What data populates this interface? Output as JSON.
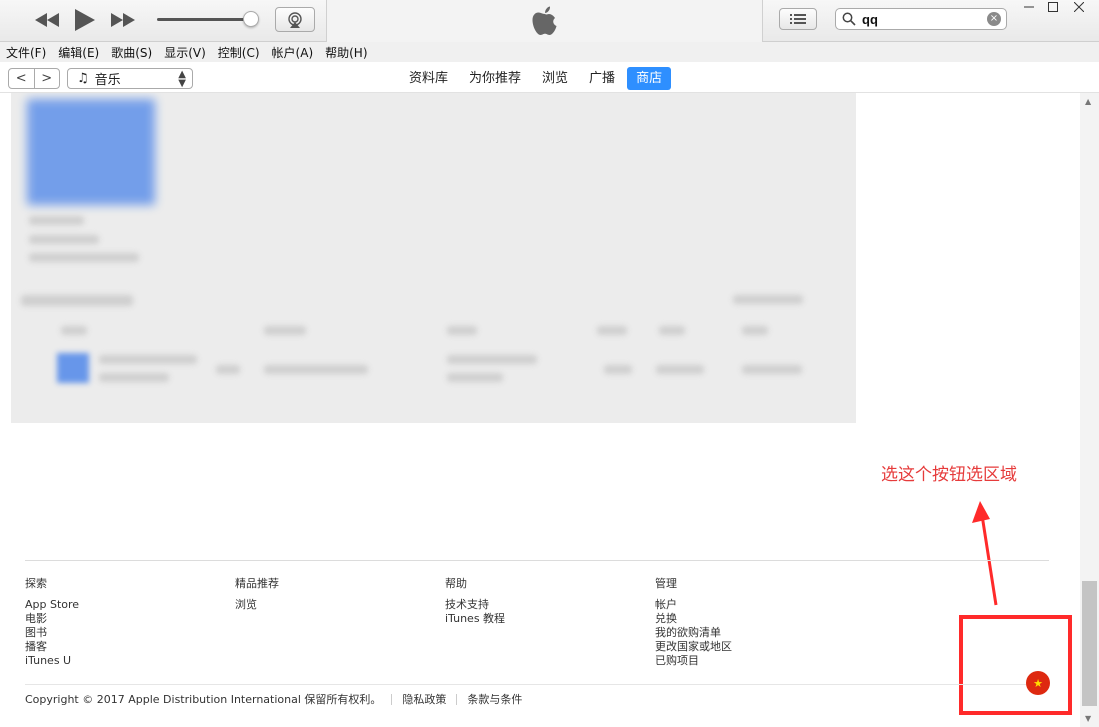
{
  "topbar": {
    "search_value": "qq",
    "search_clear": "×"
  },
  "menu": [
    "文件(F)",
    "编辑(E)",
    "歌曲(S)",
    "显示(V)",
    "控制(C)",
    "帐户(A)",
    "帮助(H)"
  ],
  "nav": {
    "back": "<",
    "forward": ">",
    "media_kind": "音乐",
    "tabs": [
      "资料库",
      "为你推荐",
      "浏览",
      "广播",
      "商店"
    ],
    "active_tab": "商店"
  },
  "annotation": {
    "text": "选这个按钮选区域",
    "color": "#e63b3b"
  },
  "footer": {
    "columns": [
      {
        "head": "探索",
        "links": [
          "App Store",
          "电影",
          "图书",
          "播客",
          "iTunes U"
        ]
      },
      {
        "head": "精品推荐",
        "links": [
          "浏览"
        ]
      },
      {
        "head": "帮助",
        "links": [
          "技术支持",
          "iTunes 教程"
        ]
      },
      {
        "head": "管理",
        "links": [
          "帐户",
          "兑换",
          "我的欲购清单",
          "更改国家或地区",
          "已购项目"
        ]
      }
    ],
    "copyright": "Copyright © 2017 Apple Distribution International 保留所有权利。",
    "privacy": "隐私政策",
    "terms": "条款与条件",
    "country_flag_icon": "china-flag-icon"
  },
  "colors": {
    "accent": "#2e8fff",
    "annotation_red": "#ff2a2a"
  }
}
